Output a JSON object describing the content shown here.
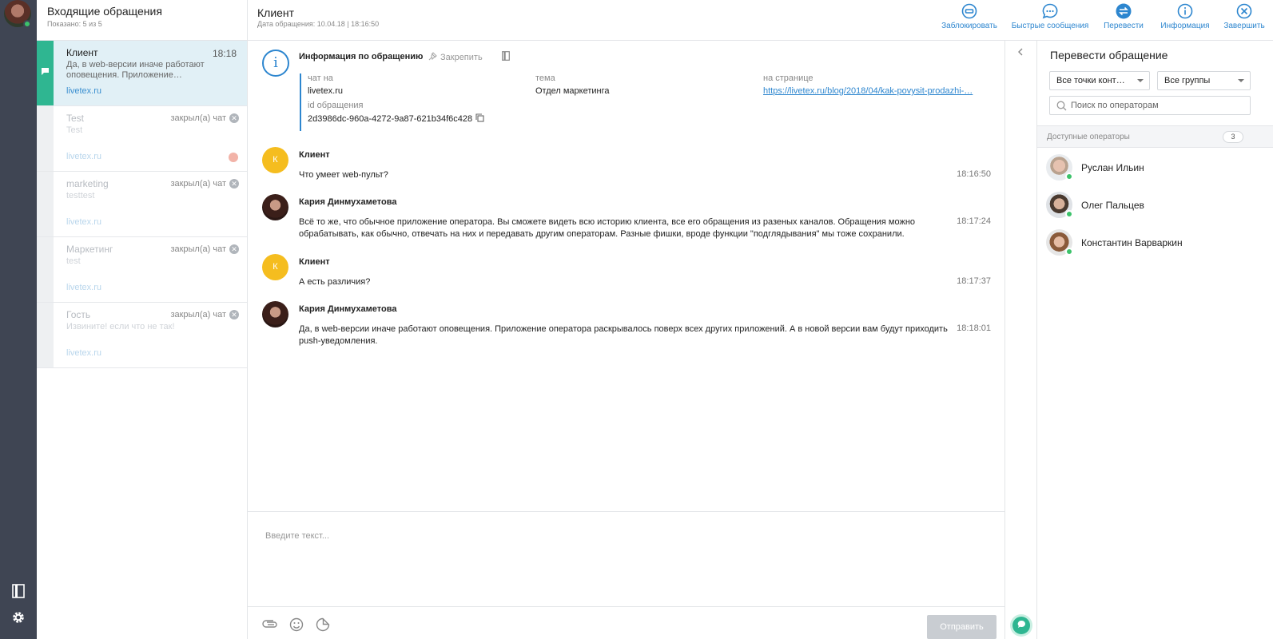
{
  "sidebar_list": {
    "title": "Входящие обращения",
    "subtitle": "Показано: 5 из 5",
    "chats": [
      {
        "name": "Клиент",
        "time": "18:18",
        "closed": "",
        "message": "Да, в web-версии иначе работают оповещения. Приложение…",
        "site": "livetex.ru"
      },
      {
        "name": "Test",
        "time": "",
        "closed": "закрыл(а) чат",
        "message": "Test",
        "site": "livetex.ru"
      },
      {
        "name": "marketing",
        "time": "",
        "closed": "закрыл(а) чат",
        "message": "testtest",
        "site": "livetex.ru"
      },
      {
        "name": "Маркетинг",
        "time": "",
        "closed": "закрыл(а) чат",
        "message": "test",
        "site": "livetex.ru"
      },
      {
        "name": "Гость",
        "time": "",
        "closed": "закрыл(а) чат",
        "message": "Извините! если что не так!",
        "site": "livetex.ru"
      }
    ]
  },
  "conversation": {
    "title": "Клиент",
    "date": "Дата обращения: 10.04.18 | 18:16:50",
    "actions": [
      {
        "label": "Заблокировать",
        "icon": "block-icon"
      },
      {
        "label": "Быстрые сообщения",
        "icon": "quick-messages-icon"
      },
      {
        "label": "Перевести",
        "icon": "transfer-icon"
      },
      {
        "label": "Информация",
        "icon": "info-icon"
      },
      {
        "label": "Завершить",
        "icon": "close-circle-icon"
      }
    ],
    "info": {
      "title": "Информация по обращению",
      "pin_label": "Закрепить",
      "chat_on_label": "чат на",
      "chat_on_value": "livetex.ru",
      "topic_label": "тема",
      "topic_value": "Отдел маркетинга",
      "page_label": "на странице",
      "page_value": "https://livetex.ru/blog/2018/04/kak-povysit-prodazhi-…",
      "id_label": "id обращения",
      "id_value": "2d3986dc-960a-4272-9a87-621b34f6c428"
    },
    "messages": [
      {
        "author": "Клиент",
        "avatar_letter": "К",
        "text": "Что умеет web-пульт?",
        "time": "18:16:50"
      },
      {
        "author": "Кария Динмухаметова",
        "avatar_letter": "",
        "text": "Всё то же, что обычное приложение оператора. Вы сможете видеть всю историю клиента, все его обращения из разеных каналов. Обращения можно обрабатывать, как обычно, отвечать на них и передавать другим операторам. Разные фишки, вроде функции \"подглядывания\" мы тоже сохранили.",
        "time": "18:17:24"
      },
      {
        "author": "Клиент",
        "avatar_letter": "К",
        "text": "А есть различия?",
        "time": "18:17:37"
      },
      {
        "author": "Кария Динмухаметова",
        "avatar_letter": "",
        "text": "Да, в web-версии иначе работают оповещения. Приложение оператора раскрывалось поверх всех других приложений. А в новой версии вам будут приходить push-уведомления.",
        "time": "18:18:01"
      }
    ],
    "composer_placeholder": "Введите текст...",
    "send_label": "Отправить"
  },
  "transfer": {
    "title": "Перевести обращение",
    "select_points": "Все точки конт…",
    "select_groups": "Все группы",
    "search_placeholder": "Поиск по операторам",
    "available_label": "Доступные операторы",
    "available_count": "3",
    "operators": [
      {
        "name": "Руслан Ильин"
      },
      {
        "name": "Олег Пальцев"
      },
      {
        "name": "Константин Варваркин"
      }
    ]
  },
  "colors": {
    "accent": "#2d86cf",
    "green": "#2fb691",
    "rail": "#3f4553",
    "avatar_yellow": "#f5bd1f"
  }
}
